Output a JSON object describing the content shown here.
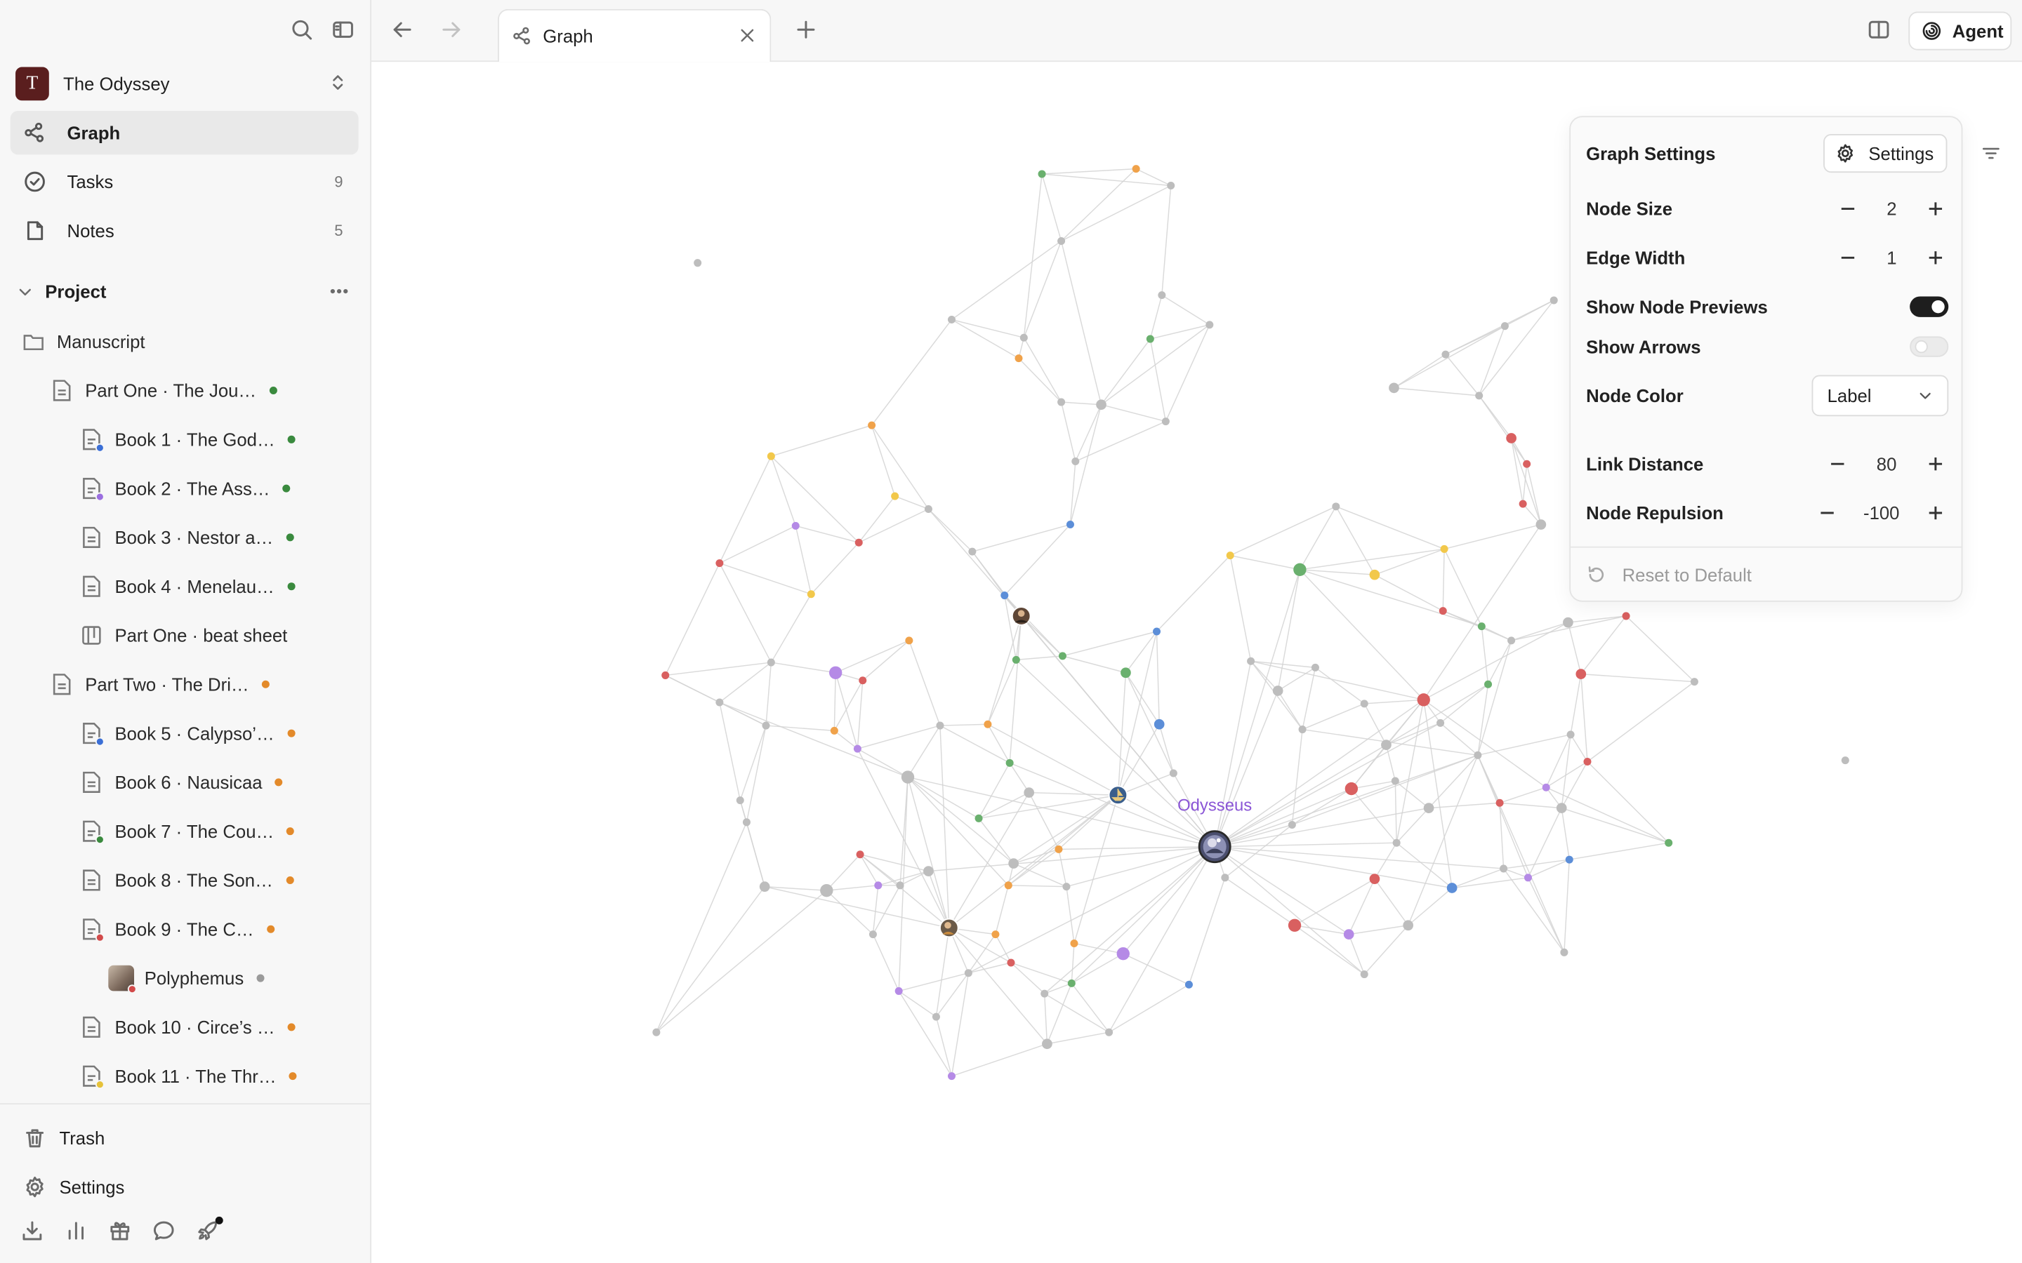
{
  "workspace": {
    "initial": "T",
    "name": "The Odyssey"
  },
  "nav": [
    {
      "label": "Graph",
      "count": ""
    },
    {
      "label": "Tasks",
      "count": "9"
    },
    {
      "label": "Notes",
      "count": "5"
    }
  ],
  "project": {
    "label": "Project",
    "items": [
      {
        "label": "Manuscript"
      },
      {
        "label": "Part One · The Jou…",
        "status": "#3a8a3e"
      },
      {
        "label": "Book 1 · The God…",
        "status": "#3a8a3e",
        "badge": "#3b6fd6"
      },
      {
        "label": "Book 2 · The Ass…",
        "status": "#3a8a3e",
        "badge": "#9b6ee0"
      },
      {
        "label": "Book 3 · Nestor a…",
        "status": "#3a8a3e"
      },
      {
        "label": "Book 4 · Menelau…",
        "status": "#3a8a3e"
      },
      {
        "label": "Part One · beat sheet"
      },
      {
        "label": "Part Two · The Dri…",
        "status": "#e38a2a"
      },
      {
        "label": "Book 5 · Calypso’…",
        "status": "#e38a2a",
        "badge": "#3b6fd6"
      },
      {
        "label": "Book 6 · Nausicaa",
        "status": "#e38a2a"
      },
      {
        "label": "Book 7 · The Cou…",
        "status": "#e38a2a",
        "badge": "#3a8a3e"
      },
      {
        "label": "Book 8 · The Son…",
        "status": "#e38a2a"
      },
      {
        "label": "Book 9 · The C…",
        "status": "#e38a2a",
        "badge": "#d24a4a"
      },
      {
        "label": "Polyphemus",
        "status": "#9a9a9a",
        "badge": "#d24a4a"
      },
      {
        "label": "Book 10 · Circe’s …",
        "status": "#e38a2a"
      },
      {
        "label": "Book 11 · The Thr…",
        "status": "#e38a2a",
        "badge": "#e6c23a"
      }
    ]
  },
  "bottom": {
    "trash": "Trash",
    "settings": "Settings"
  },
  "tab": {
    "label": "Graph"
  },
  "agent": {
    "label": "Agent"
  },
  "graph": {
    "focus_label": "Odysseus",
    "label_color": "#8a55d6"
  },
  "panel": {
    "title": "Graph Settings",
    "settings_button": "Settings",
    "node_size": {
      "label": "Node Size",
      "value": "2"
    },
    "edge_width": {
      "label": "Edge Width",
      "value": "1"
    },
    "show_node_previews": {
      "label": "Show Node Previews",
      "enabled": true
    },
    "show_arrows": {
      "label": "Show Arrows",
      "enabled": false
    },
    "node_color": {
      "label": "Node Color",
      "value": "Label"
    },
    "link_distance": {
      "label": "Link Distance",
      "value": "80"
    },
    "node_repulsion": {
      "label": "Node Repulsion",
      "value": "-100"
    },
    "reset": "Reset to Default"
  }
}
